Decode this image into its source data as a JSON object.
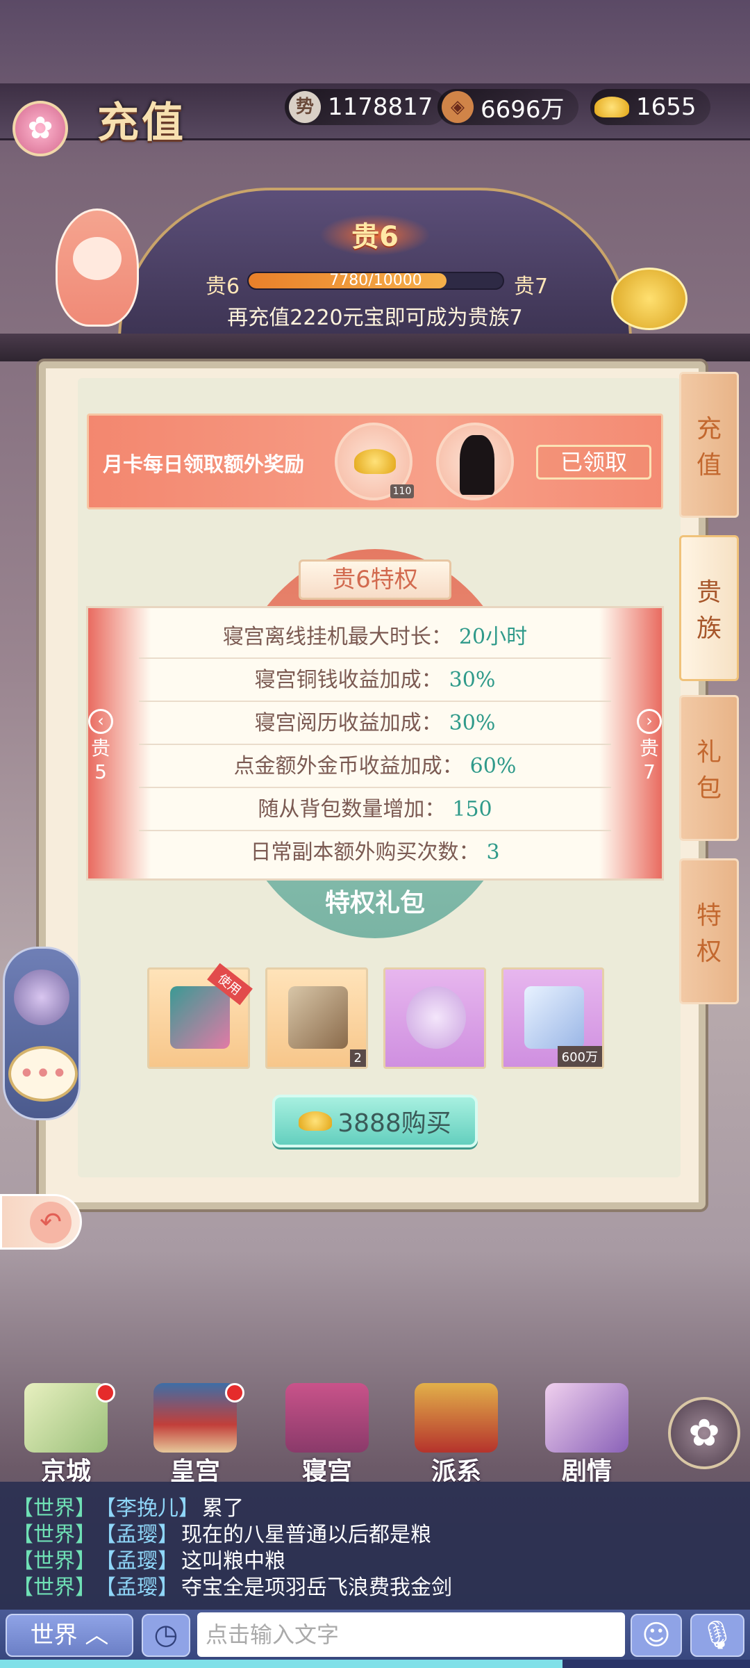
{
  "header": {
    "title": "充值",
    "resources": [
      {
        "icon": "power-icon",
        "value": "1178817"
      },
      {
        "icon": "copper-coin-icon",
        "value": "6696万"
      },
      {
        "icon": "gold-ingot-icon",
        "value": "1655"
      }
    ]
  },
  "vip": {
    "current_title": "贵6",
    "left_label": "贵6",
    "right_label": "贵7",
    "progress_text": "7780/10000",
    "progress_fraction": 0.778,
    "hint": "再充值2220元宝即可成为贵族7"
  },
  "month_card": {
    "text": "月卡每日领取额外奖励",
    "reward_count": "110",
    "claimed_label": "已领取"
  },
  "privileges": {
    "title": "贵6特权",
    "prev": {
      "line1": "贵",
      "line2": "5"
    },
    "next": {
      "line1": "贵",
      "line2": "7"
    },
    "rows": [
      {
        "label": "寝宫离线挂机最大时长：",
        "value": "20小时"
      },
      {
        "label": "寝宫铜钱收益加成：",
        "value": "30%"
      },
      {
        "label": "寝宫阅历收益加成：",
        "value": "30%"
      },
      {
        "label": "点金额外金币收益加成：",
        "value": "60%"
      },
      {
        "label": "随从背包数量增加：",
        "value": "150"
      },
      {
        "label": "日常副本额外购买次数：",
        "value": "3"
      }
    ]
  },
  "gift_pack": {
    "title": "特权礼包",
    "items": [
      {
        "icon": "gift-box-icon",
        "ribbon": "使用",
        "tag": ""
      },
      {
        "icon": "book-icon",
        "ribbon": "",
        "tag": "2"
      },
      {
        "icon": "jade-pendant-icon",
        "ribbon": "",
        "tag": ""
      },
      {
        "icon": "scroll-icon",
        "ribbon": "",
        "tag": "600万"
      }
    ],
    "buy_label": "3888购买"
  },
  "right_tabs": [
    {
      "line1": "充",
      "line2": "值"
    },
    {
      "line1": "贵",
      "line2": "族"
    },
    {
      "line1": "礼",
      "line2": "包"
    },
    {
      "line1": "特",
      "line2": "权"
    }
  ],
  "bottom_nav": [
    {
      "label": "京城",
      "badge": true
    },
    {
      "label": "皇宫",
      "badge": true
    },
    {
      "label": "寝宫",
      "badge": false
    },
    {
      "label": "派系",
      "badge": false
    },
    {
      "label": "剧情",
      "badge": false
    }
  ],
  "chat": {
    "messages": [
      {
        "channel": "【世界】",
        "name": "【李挽儿】",
        "text": "累了"
      },
      {
        "channel": "【世界】",
        "name": "【孟璎】",
        "text": "现在的八星普通以后都是粮"
      },
      {
        "channel": "【世界】",
        "name": "【孟璎】",
        "text": "这叫粮中粮"
      },
      {
        "channel": "【世界】",
        "name": "【孟璎】",
        "text": "夺宝全是项羽岳飞浪费我金剑"
      }
    ],
    "channel_label": "世界 ︿",
    "input_placeholder": "点击输入文字"
  },
  "colors": {
    "accent_teal": "#64cfbe",
    "vip_orange": "#e9802a",
    "tab_brown": "#c3682f"
  }
}
